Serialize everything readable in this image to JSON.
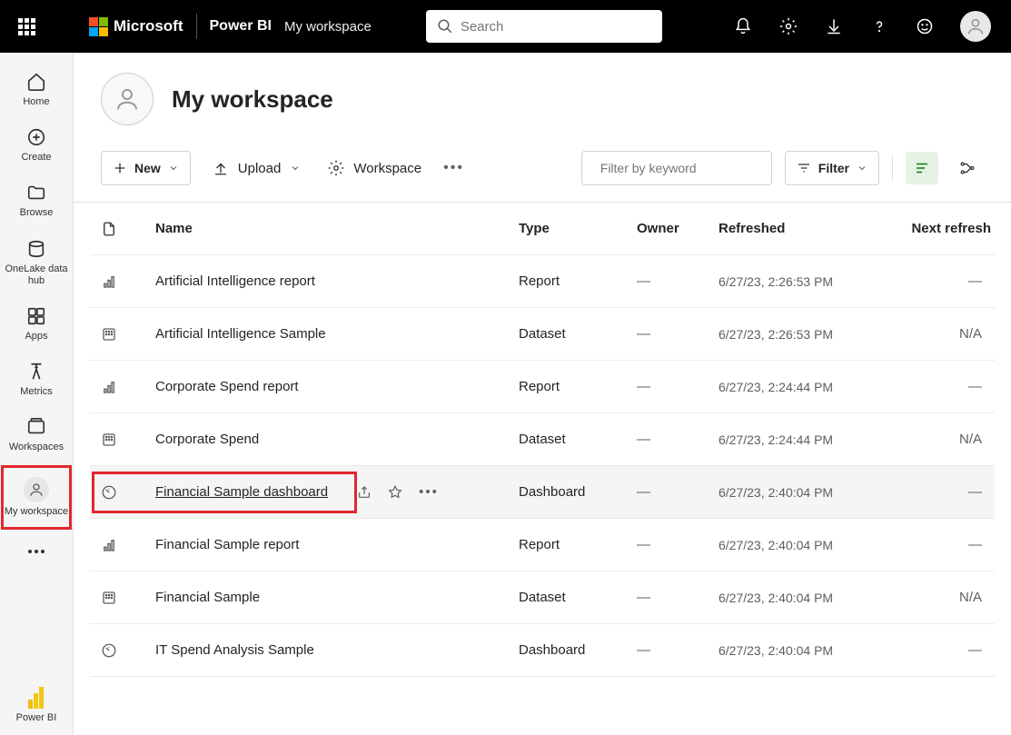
{
  "header": {
    "brand": "Microsoft",
    "product": "Power BI",
    "workspace": "My workspace",
    "search_placeholder": "Search"
  },
  "leftnav": [
    {
      "id": "home",
      "label": "Home"
    },
    {
      "id": "create",
      "label": "Create"
    },
    {
      "id": "browse",
      "label": "Browse"
    },
    {
      "id": "onelake",
      "label": "OneLake data hub"
    },
    {
      "id": "apps",
      "label": "Apps"
    },
    {
      "id": "metrics",
      "label": "Metrics"
    },
    {
      "id": "workspaces",
      "label": "Workspaces"
    },
    {
      "id": "myworkspace",
      "label": "My workspace"
    }
  ],
  "leftnav_footer": "Power BI",
  "workspace": {
    "title": "My workspace"
  },
  "toolbar": {
    "new_label": "New",
    "upload_label": "Upload",
    "settings_label": "Workspace",
    "filter_placeholder": "Filter by keyword",
    "filter_btn": "Filter"
  },
  "columns": {
    "name": "Name",
    "type": "Type",
    "owner": "Owner",
    "refreshed": "Refreshed",
    "next_refresh": "Next refresh"
  },
  "rows": [
    {
      "icon": "report",
      "name": "Artificial Intelligence report",
      "type": "Report",
      "owner": "—",
      "refreshed": "6/27/23, 2:26:53 PM",
      "next": "—"
    },
    {
      "icon": "dataset",
      "name": "Artificial Intelligence Sample",
      "type": "Dataset",
      "owner": "—",
      "refreshed": "6/27/23, 2:26:53 PM",
      "next": "N/A"
    },
    {
      "icon": "report",
      "name": "Corporate Spend report",
      "type": "Report",
      "owner": "—",
      "refreshed": "6/27/23, 2:24:44 PM",
      "next": "—"
    },
    {
      "icon": "dataset",
      "name": "Corporate Spend",
      "type": "Dataset",
      "owner": "—",
      "refreshed": "6/27/23, 2:24:44 PM",
      "next": "N/A"
    },
    {
      "icon": "dashboard",
      "name": "Financial Sample dashboard",
      "type": "Dashboard",
      "owner": "—",
      "refreshed": "6/27/23, 2:40:04 PM",
      "next": "—",
      "highlighted": true,
      "redbox": true,
      "underlined": true,
      "actions": true
    },
    {
      "icon": "report",
      "name": "Financial Sample report",
      "type": "Report",
      "owner": "—",
      "refreshed": "6/27/23, 2:40:04 PM",
      "next": "—"
    },
    {
      "icon": "dataset",
      "name": "Financial Sample",
      "type": "Dataset",
      "owner": "—",
      "refreshed": "6/27/23, 2:40:04 PM",
      "next": "N/A"
    },
    {
      "icon": "dashboard",
      "name": "IT Spend Analysis Sample",
      "type": "Dashboard",
      "owner": "—",
      "refreshed": "6/27/23, 2:40:04 PM",
      "next": "—"
    }
  ]
}
